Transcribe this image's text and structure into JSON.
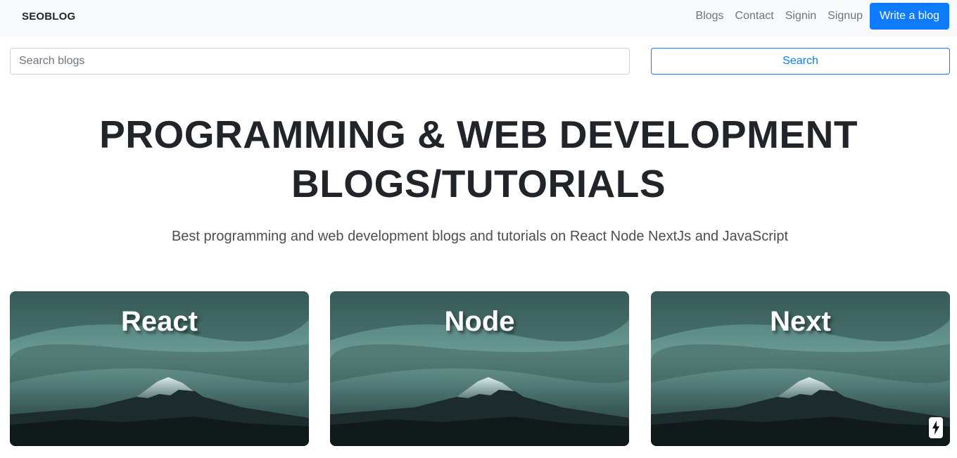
{
  "navbar": {
    "brand": "SEOBLOG",
    "links": [
      "Blogs",
      "Contact",
      "Signin",
      "Signup"
    ],
    "cta": "Write a blog"
  },
  "search": {
    "placeholder": "Search blogs",
    "button_label": "Search"
  },
  "hero": {
    "title_line1": "PROGRAMMING & WEB DEVELOPMENT",
    "title_line2": "BLOGS/TUTORIALS",
    "subtitle": "Best programming and web development blogs and tutorials on React Node NextJs and JavaScript"
  },
  "cards": [
    {
      "label": "React"
    },
    {
      "label": "Node"
    },
    {
      "label": "Next"
    }
  ],
  "icons": {
    "badge": "lightning-bolt-icon"
  },
  "colors": {
    "primary": "#0d7bfb",
    "navbar_bg": "#f8f9fa",
    "text_dark": "#212529",
    "link_muted": "#6c757d"
  }
}
